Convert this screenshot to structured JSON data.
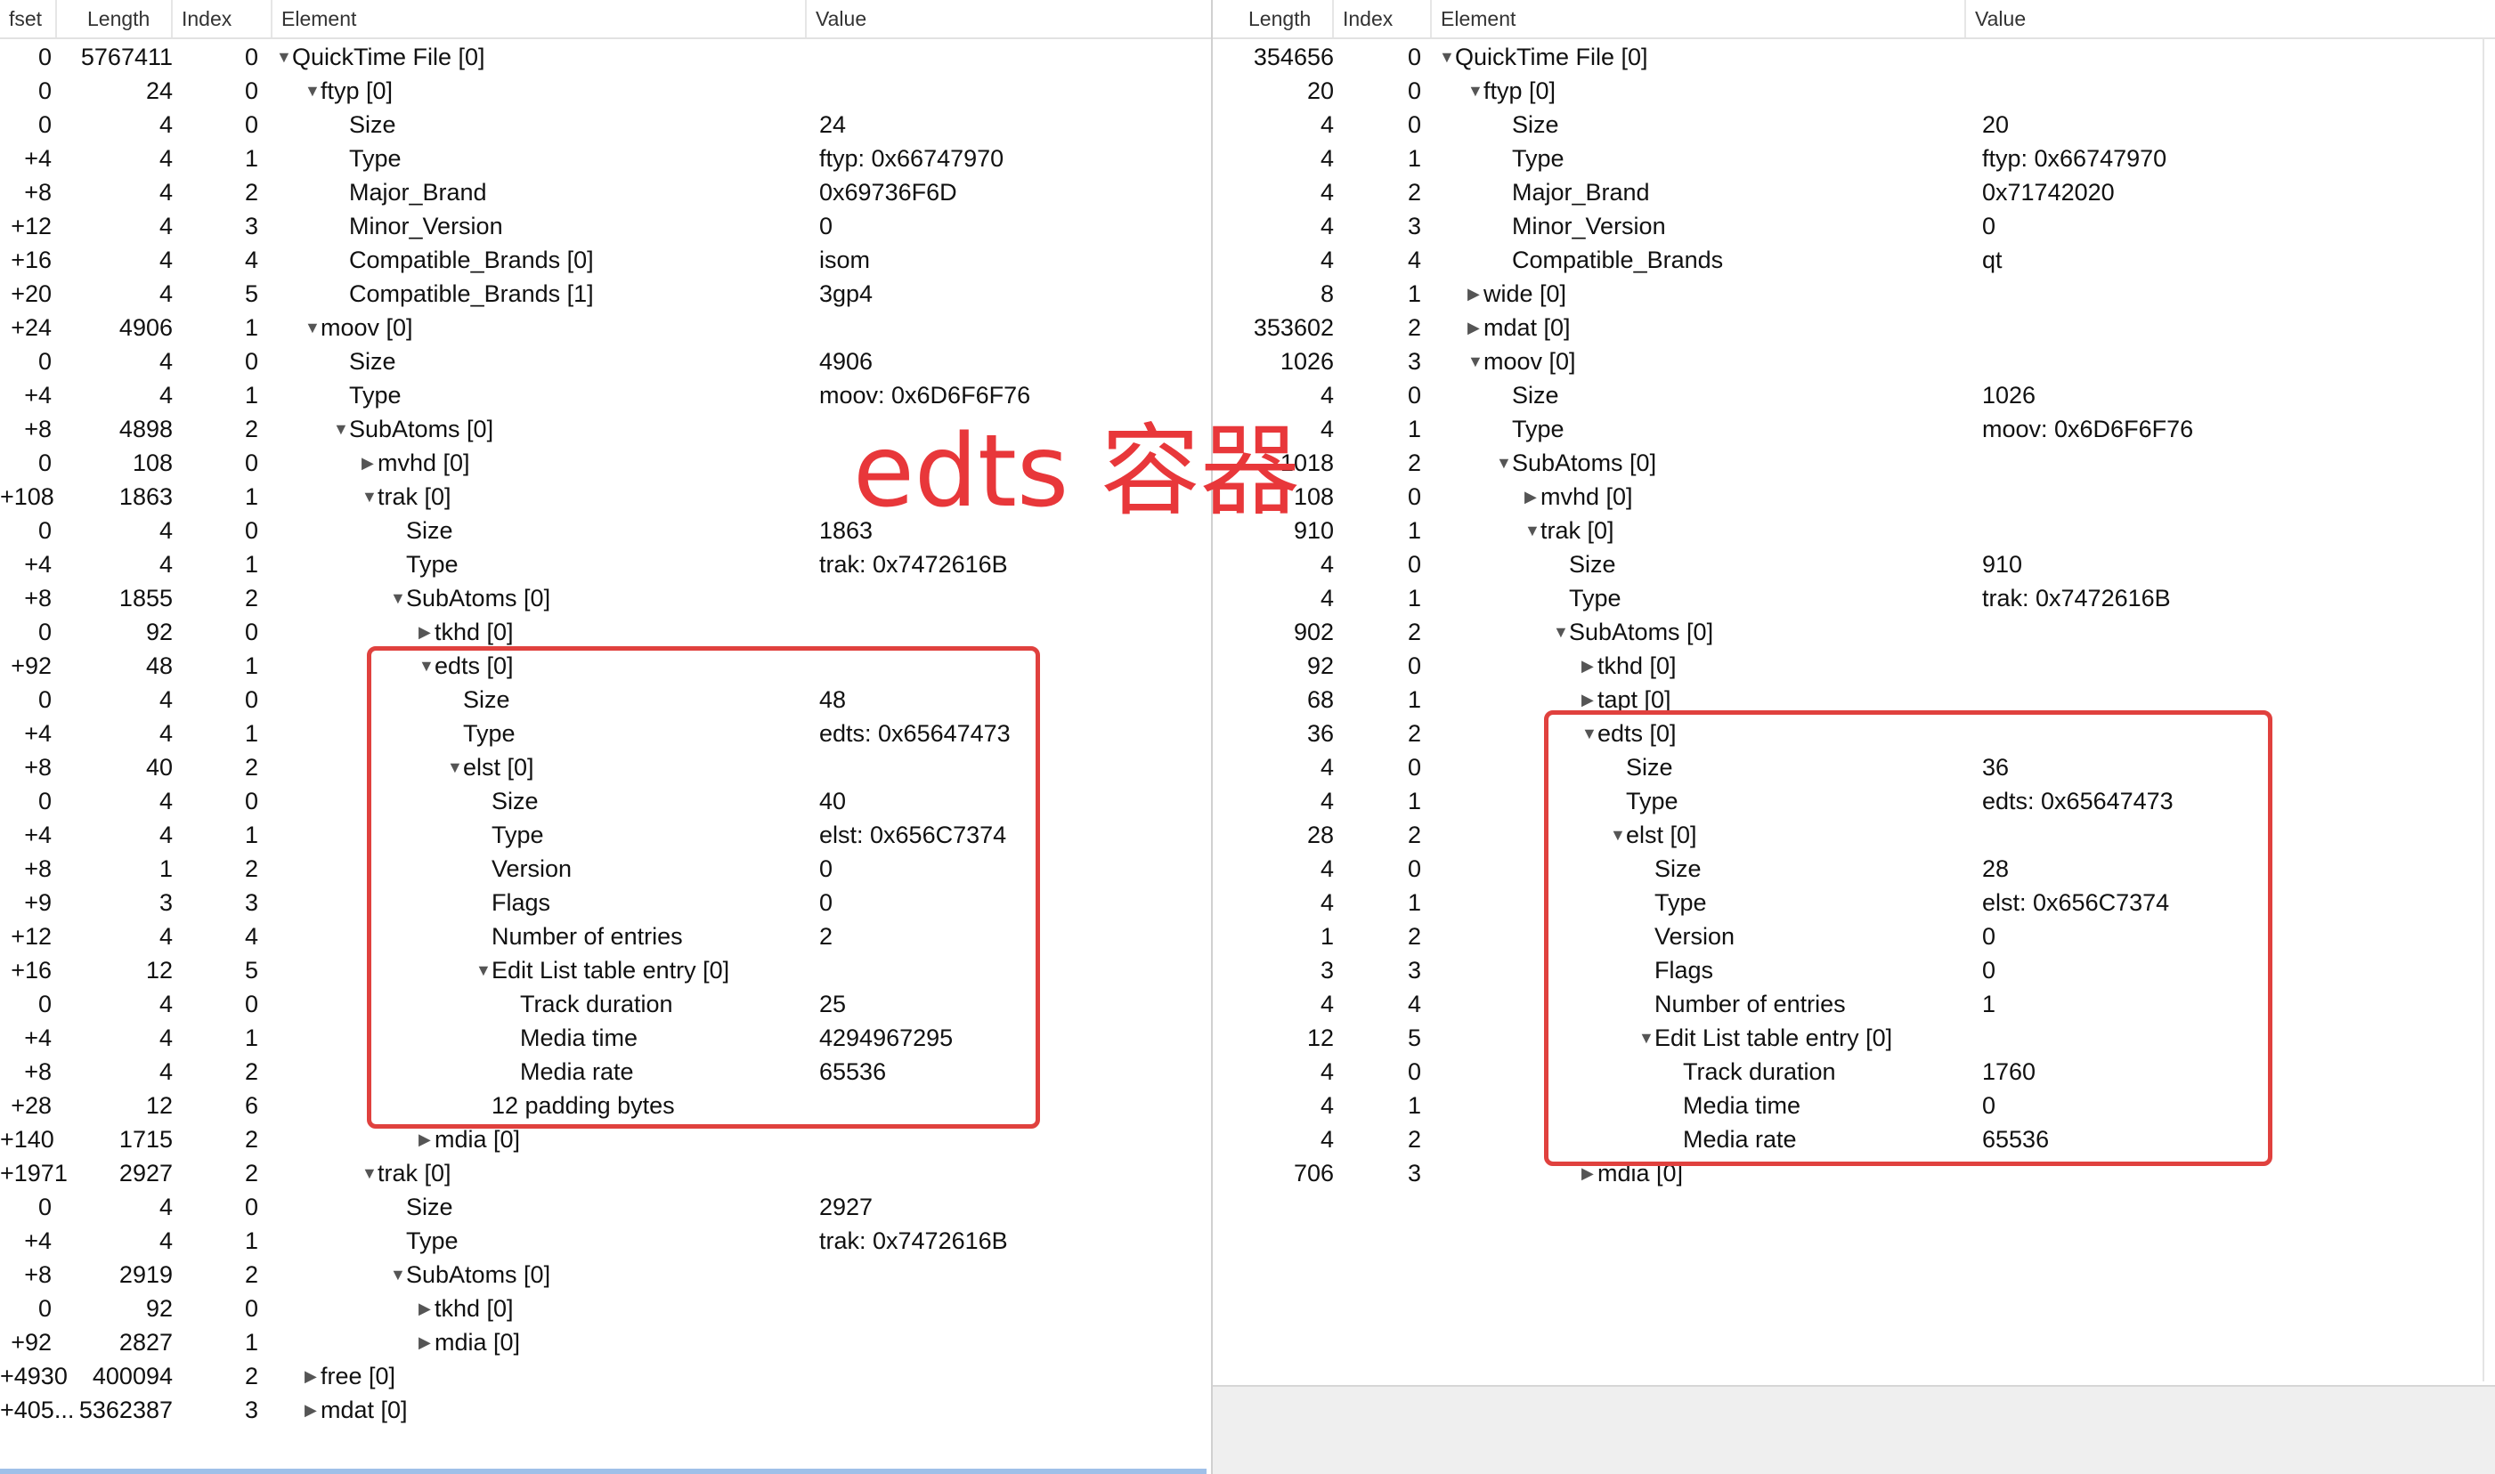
{
  "accent_color": "#e0413e",
  "annotation": "edts 容器",
  "left": {
    "headers": {
      "offset": "fset",
      "length": "Length",
      "index": "Index",
      "element": "Element",
      "value": "Value"
    },
    "rows": [
      {
        "o": "0",
        "l": "5767411",
        "i": "0",
        "d": 0,
        "t": "open",
        "e": "QuickTime File [0]",
        "v": ""
      },
      {
        "o": "0",
        "l": "24",
        "i": "0",
        "d": 1,
        "t": "open",
        "e": "ftyp [0]",
        "v": ""
      },
      {
        "o": "0",
        "l": "4",
        "i": "0",
        "d": 2,
        "t": "",
        "e": "Size",
        "v": "24"
      },
      {
        "o": "+4",
        "l": "4",
        "i": "1",
        "d": 2,
        "t": "",
        "e": "Type",
        "v": "ftyp: 0x66747970"
      },
      {
        "o": "+8",
        "l": "4",
        "i": "2",
        "d": 2,
        "t": "",
        "e": "Major_Brand",
        "v": "0x69736F6D"
      },
      {
        "o": "+12",
        "l": "4",
        "i": "3",
        "d": 2,
        "t": "",
        "e": "Minor_Version",
        "v": "0"
      },
      {
        "o": "+16",
        "l": "4",
        "i": "4",
        "d": 2,
        "t": "",
        "e": "Compatible_Brands [0]",
        "v": "isom"
      },
      {
        "o": "+20",
        "l": "4",
        "i": "5",
        "d": 2,
        "t": "",
        "e": "Compatible_Brands [1]",
        "v": "3gp4"
      },
      {
        "o": "+24",
        "l": "4906",
        "i": "1",
        "d": 1,
        "t": "open",
        "e": "moov [0]",
        "v": ""
      },
      {
        "o": "0",
        "l": "4",
        "i": "0",
        "d": 2,
        "t": "",
        "e": "Size",
        "v": "4906"
      },
      {
        "o": "+4",
        "l": "4",
        "i": "1",
        "d": 2,
        "t": "",
        "e": "Type",
        "v": "moov: 0x6D6F6F76"
      },
      {
        "o": "+8",
        "l": "4898",
        "i": "2",
        "d": 2,
        "t": "open",
        "e": "SubAtoms [0]",
        "v": ""
      },
      {
        "o": "0",
        "l": "108",
        "i": "0",
        "d": 3,
        "t": "closed",
        "e": "mvhd [0]",
        "v": ""
      },
      {
        "o": "+108",
        "l": "1863",
        "i": "1",
        "d": 3,
        "t": "open",
        "e": "trak [0]",
        "v": ""
      },
      {
        "o": "0",
        "l": "4",
        "i": "0",
        "d": 4,
        "t": "",
        "e": "Size",
        "v": "1863"
      },
      {
        "o": "+4",
        "l": "4",
        "i": "1",
        "d": 4,
        "t": "",
        "e": "Type",
        "v": "trak: 0x7472616B"
      },
      {
        "o": "+8",
        "l": "1855",
        "i": "2",
        "d": 4,
        "t": "open",
        "e": "SubAtoms [0]",
        "v": ""
      },
      {
        "o": "0",
        "l": "92",
        "i": "0",
        "d": 5,
        "t": "closed",
        "e": "tkhd [0]",
        "v": ""
      },
      {
        "o": "+92",
        "l": "48",
        "i": "1",
        "d": 5,
        "t": "open",
        "e": "edts [0]",
        "v": ""
      },
      {
        "o": "0",
        "l": "4",
        "i": "0",
        "d": 6,
        "t": "",
        "e": "Size",
        "v": "48"
      },
      {
        "o": "+4",
        "l": "4",
        "i": "1",
        "d": 6,
        "t": "",
        "e": "Type",
        "v": "edts: 0x65647473"
      },
      {
        "o": "+8",
        "l": "40",
        "i": "2",
        "d": 6,
        "t": "open",
        "e": "elst [0]",
        "v": ""
      },
      {
        "o": "0",
        "l": "4",
        "i": "0",
        "d": 7,
        "t": "",
        "e": "Size",
        "v": "40"
      },
      {
        "o": "+4",
        "l": "4",
        "i": "1",
        "d": 7,
        "t": "",
        "e": "Type",
        "v": "elst: 0x656C7374"
      },
      {
        "o": "+8",
        "l": "1",
        "i": "2",
        "d": 7,
        "t": "",
        "e": "Version",
        "v": "0"
      },
      {
        "o": "+9",
        "l": "3",
        "i": "3",
        "d": 7,
        "t": "",
        "e": "Flags",
        "v": "0"
      },
      {
        "o": "+12",
        "l": "4",
        "i": "4",
        "d": 7,
        "t": "",
        "e": "Number of entries",
        "v": "2"
      },
      {
        "o": "+16",
        "l": "12",
        "i": "5",
        "d": 7,
        "t": "open",
        "e": "Edit List table entry [0]",
        "v": ""
      },
      {
        "o": "0",
        "l": "4",
        "i": "0",
        "d": 8,
        "t": "",
        "e": "Track duration",
        "v": "25"
      },
      {
        "o": "+4",
        "l": "4",
        "i": "1",
        "d": 8,
        "t": "",
        "e": "Media time",
        "v": "4294967295"
      },
      {
        "o": "+8",
        "l": "4",
        "i": "2",
        "d": 8,
        "t": "",
        "e": "Media rate",
        "v": "65536"
      },
      {
        "o": "+28",
        "l": "12",
        "i": "6",
        "d": 7,
        "t": "",
        "e": "12 padding bytes",
        "v": ""
      },
      {
        "o": "+140",
        "l": "1715",
        "i": "2",
        "d": 5,
        "t": "closed",
        "e": "mdia [0]",
        "v": ""
      },
      {
        "o": "+1971",
        "l": "2927",
        "i": "2",
        "d": 3,
        "t": "open",
        "e": "trak [0]",
        "v": ""
      },
      {
        "o": "0",
        "l": "4",
        "i": "0",
        "d": 4,
        "t": "",
        "e": "Size",
        "v": "2927"
      },
      {
        "o": "+4",
        "l": "4",
        "i": "1",
        "d": 4,
        "t": "",
        "e": "Type",
        "v": "trak: 0x7472616B"
      },
      {
        "o": "+8",
        "l": "2919",
        "i": "2",
        "d": 4,
        "t": "open",
        "e": "SubAtoms [0]",
        "v": ""
      },
      {
        "o": "0",
        "l": "92",
        "i": "0",
        "d": 5,
        "t": "closed",
        "e": "tkhd [0]",
        "v": ""
      },
      {
        "o": "+92",
        "l": "2827",
        "i": "1",
        "d": 5,
        "t": "closed",
        "e": "mdia [0]",
        "v": ""
      },
      {
        "o": "+4930",
        "l": "400094",
        "i": "2",
        "d": 1,
        "t": "closed",
        "e": "free [0]",
        "v": ""
      },
      {
        "o": "+405...",
        "l": "5362387",
        "i": "3",
        "d": 1,
        "t": "closed",
        "e": "mdat [0]",
        "v": ""
      }
    ]
  },
  "right": {
    "headers": {
      "length": "Length",
      "index": "Index",
      "element": "Element",
      "value": "Value"
    },
    "rows": [
      {
        "l": "354656",
        "i": "0",
        "d": 0,
        "t": "open",
        "e": "QuickTime File [0]",
        "v": ""
      },
      {
        "l": "20",
        "i": "0",
        "d": 1,
        "t": "open",
        "e": "ftyp [0]",
        "v": ""
      },
      {
        "l": "4",
        "i": "0",
        "d": 2,
        "t": "",
        "e": "Size",
        "v": "20"
      },
      {
        "l": "4",
        "i": "1",
        "d": 2,
        "t": "",
        "e": "Type",
        "v": "ftyp: 0x66747970"
      },
      {
        "l": "4",
        "i": "2",
        "d": 2,
        "t": "",
        "e": "Major_Brand",
        "v": "0x71742020"
      },
      {
        "l": "4",
        "i": "3",
        "d": 2,
        "t": "",
        "e": "Minor_Version",
        "v": "0"
      },
      {
        "l": "4",
        "i": "4",
        "d": 2,
        "t": "",
        "e": "Compatible_Brands",
        "v": "qt"
      },
      {
        "l": "8",
        "i": "1",
        "d": 1,
        "t": "closed",
        "e": "wide [0]",
        "v": ""
      },
      {
        "l": "353602",
        "i": "2",
        "d": 1,
        "t": "closed",
        "e": "mdat [0]",
        "v": ""
      },
      {
        "l": "1026",
        "i": "3",
        "d": 1,
        "t": "open",
        "e": "moov [0]",
        "v": ""
      },
      {
        "l": "4",
        "i": "0",
        "d": 2,
        "t": "",
        "e": "Size",
        "v": "1026"
      },
      {
        "l": "4",
        "i": "1",
        "d": 2,
        "t": "",
        "e": "Type",
        "v": "moov: 0x6D6F6F76"
      },
      {
        "l": "1018",
        "i": "2",
        "d": 2,
        "t": "open",
        "e": "SubAtoms [0]",
        "v": ""
      },
      {
        "l": "108",
        "i": "0",
        "d": 3,
        "t": "closed",
        "e": "mvhd [0]",
        "v": ""
      },
      {
        "l": "910",
        "i": "1",
        "d": 3,
        "t": "open",
        "e": "trak [0]",
        "v": ""
      },
      {
        "l": "4",
        "i": "0",
        "d": 4,
        "t": "",
        "e": "Size",
        "v": "910"
      },
      {
        "l": "4",
        "i": "1",
        "d": 4,
        "t": "",
        "e": "Type",
        "v": "trak: 0x7472616B"
      },
      {
        "l": "902",
        "i": "2",
        "d": 4,
        "t": "open",
        "e": "SubAtoms [0]",
        "v": ""
      },
      {
        "l": "92",
        "i": "0",
        "d": 5,
        "t": "closed",
        "e": "tkhd [0]",
        "v": ""
      },
      {
        "l": "68",
        "i": "1",
        "d": 5,
        "t": "closed",
        "e": "tapt [0]",
        "v": ""
      },
      {
        "l": "36",
        "i": "2",
        "d": 5,
        "t": "open",
        "e": "edts [0]",
        "v": ""
      },
      {
        "l": "4",
        "i": "0",
        "d": 6,
        "t": "",
        "e": "Size",
        "v": "36"
      },
      {
        "l": "4",
        "i": "1",
        "d": 6,
        "t": "",
        "e": "Type",
        "v": "edts: 0x65647473"
      },
      {
        "l": "28",
        "i": "2",
        "d": 6,
        "t": "open",
        "e": "elst [0]",
        "v": ""
      },
      {
        "l": "4",
        "i": "0",
        "d": 7,
        "t": "",
        "e": "Size",
        "v": "28"
      },
      {
        "l": "4",
        "i": "1",
        "d": 7,
        "t": "",
        "e": "Type",
        "v": "elst: 0x656C7374"
      },
      {
        "l": "1",
        "i": "2",
        "d": 7,
        "t": "",
        "e": "Version",
        "v": "0"
      },
      {
        "l": "3",
        "i": "3",
        "d": 7,
        "t": "",
        "e": "Flags",
        "v": "0"
      },
      {
        "l": "4",
        "i": "4",
        "d": 7,
        "t": "",
        "e": "Number of entries",
        "v": "1"
      },
      {
        "l": "12",
        "i": "5",
        "d": 7,
        "t": "open",
        "e": "Edit List table entry [0]",
        "v": ""
      },
      {
        "l": "4",
        "i": "0",
        "d": 8,
        "t": "",
        "e": "Track duration",
        "v": "1760"
      },
      {
        "l": "4",
        "i": "1",
        "d": 8,
        "t": "",
        "e": "Media time",
        "v": "0"
      },
      {
        "l": "4",
        "i": "2",
        "d": 8,
        "t": "",
        "e": "Media rate",
        "v": "65536"
      },
      {
        "l": "706",
        "i": "3",
        "d": 5,
        "t": "closed",
        "e": "mdia [0]",
        "v": ""
      }
    ]
  }
}
